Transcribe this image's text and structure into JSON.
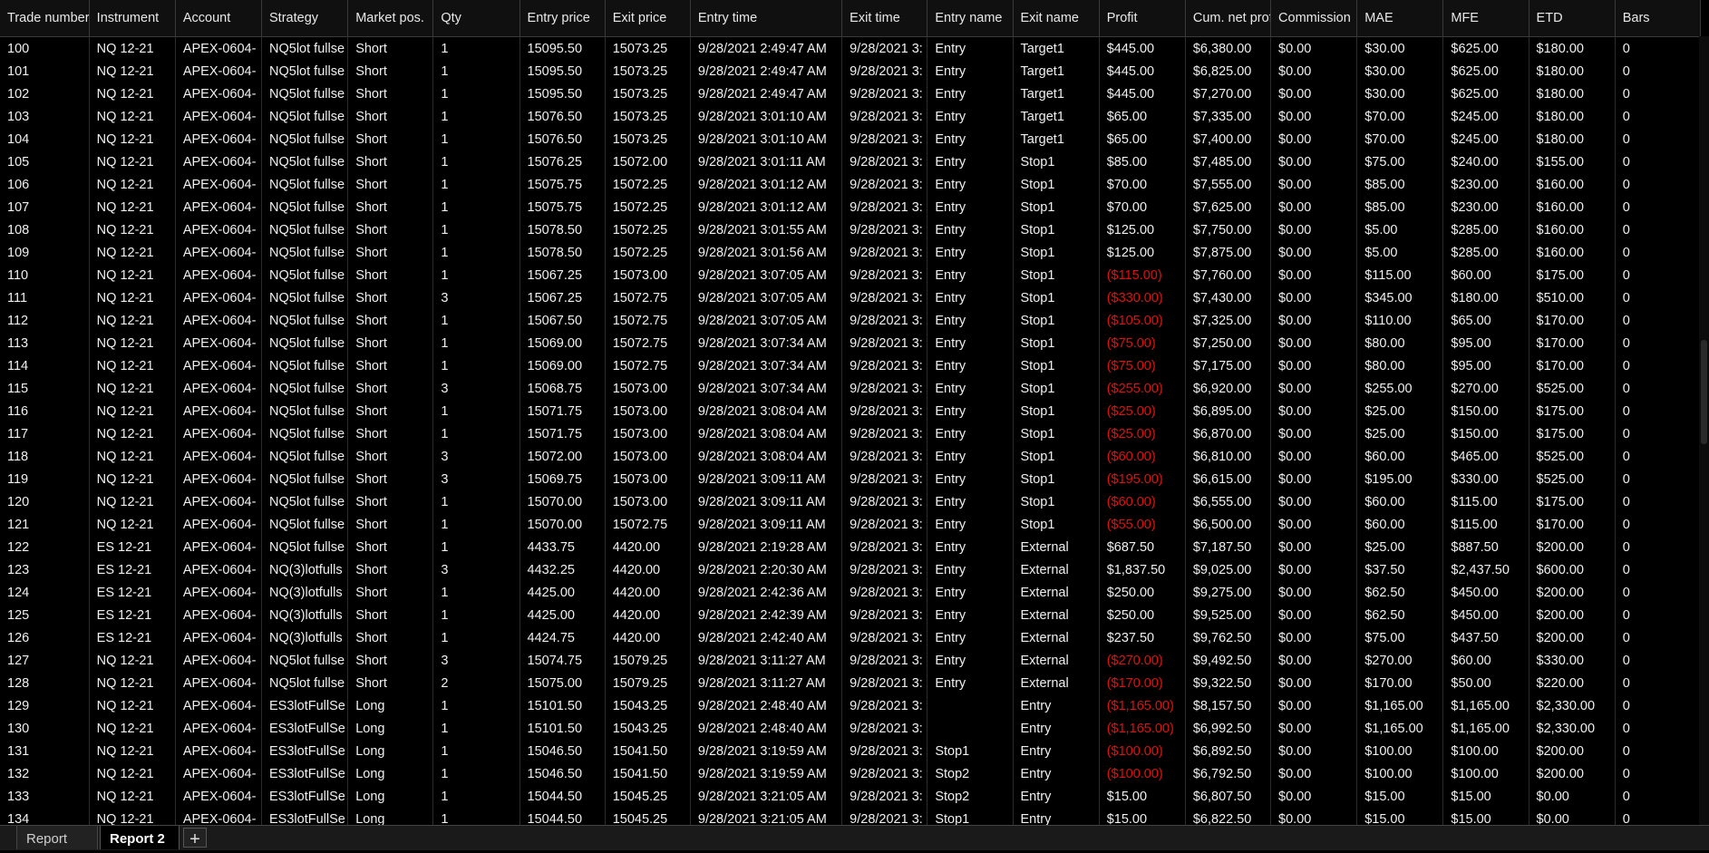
{
  "columns": [
    "Trade number",
    "Instrument",
    "Account",
    "Strategy",
    "Market pos.",
    "Qty",
    "Entry price",
    "Exit price",
    "Entry time",
    "Exit time",
    "Entry name",
    "Exit name",
    "Profit",
    "Cum. net profit",
    "Commission",
    "MAE",
    "MFE",
    "ETD",
    "Bars"
  ],
  "rows": [
    [
      "100",
      "NQ 12-21",
      "APEX-0604-",
      "NQ5lot fullse",
      "Short",
      "1",
      "15095.50",
      "15073.25",
      "9/28/2021 2:49:47 AM",
      "9/28/2021 3:",
      "Entry",
      "Target1",
      "$445.00",
      "$6,380.00",
      "$0.00",
      "$30.00",
      "$625.00",
      "$180.00",
      "0"
    ],
    [
      "101",
      "NQ 12-21",
      "APEX-0604-",
      "NQ5lot fullse",
      "Short",
      "1",
      "15095.50",
      "15073.25",
      "9/28/2021 2:49:47 AM",
      "9/28/2021 3:",
      "Entry",
      "Target1",
      "$445.00",
      "$6,825.00",
      "$0.00",
      "$30.00",
      "$625.00",
      "$180.00",
      "0"
    ],
    [
      "102",
      "NQ 12-21",
      "APEX-0604-",
      "NQ5lot fullse",
      "Short",
      "1",
      "15095.50",
      "15073.25",
      "9/28/2021 2:49:47 AM",
      "9/28/2021 3:",
      "Entry",
      "Target1",
      "$445.00",
      "$7,270.00",
      "$0.00",
      "$30.00",
      "$625.00",
      "$180.00",
      "0"
    ],
    [
      "103",
      "NQ 12-21",
      "APEX-0604-",
      "NQ5lot fullse",
      "Short",
      "1",
      "15076.50",
      "15073.25",
      "9/28/2021 3:01:10 AM",
      "9/28/2021 3:",
      "Entry",
      "Target1",
      "$65.00",
      "$7,335.00",
      "$0.00",
      "$70.00",
      "$245.00",
      "$180.00",
      "0"
    ],
    [
      "104",
      "NQ 12-21",
      "APEX-0604-",
      "NQ5lot fullse",
      "Short",
      "1",
      "15076.50",
      "15073.25",
      "9/28/2021 3:01:10 AM",
      "9/28/2021 3:",
      "Entry",
      "Target1",
      "$65.00",
      "$7,400.00",
      "$0.00",
      "$70.00",
      "$245.00",
      "$180.00",
      "0"
    ],
    [
      "105",
      "NQ 12-21",
      "APEX-0604-",
      "NQ5lot fullse",
      "Short",
      "1",
      "15076.25",
      "15072.00",
      "9/28/2021 3:01:11 AM",
      "9/28/2021 3:",
      "Entry",
      "Stop1",
      "$85.00",
      "$7,485.00",
      "$0.00",
      "$75.00",
      "$240.00",
      "$155.00",
      "0"
    ],
    [
      "106",
      "NQ 12-21",
      "APEX-0604-",
      "NQ5lot fullse",
      "Short",
      "1",
      "15075.75",
      "15072.25",
      "9/28/2021 3:01:12 AM",
      "9/28/2021 3:",
      "Entry",
      "Stop1",
      "$70.00",
      "$7,555.00",
      "$0.00",
      "$85.00",
      "$230.00",
      "$160.00",
      "0"
    ],
    [
      "107",
      "NQ 12-21",
      "APEX-0604-",
      "NQ5lot fullse",
      "Short",
      "1",
      "15075.75",
      "15072.25",
      "9/28/2021 3:01:12 AM",
      "9/28/2021 3:",
      "Entry",
      "Stop1",
      "$70.00",
      "$7,625.00",
      "$0.00",
      "$85.00",
      "$230.00",
      "$160.00",
      "0"
    ],
    [
      "108",
      "NQ 12-21",
      "APEX-0604-",
      "NQ5lot fullse",
      "Short",
      "1",
      "15078.50",
      "15072.25",
      "9/28/2021 3:01:55 AM",
      "9/28/2021 3:",
      "Entry",
      "Stop1",
      "$125.00",
      "$7,750.00",
      "$0.00",
      "$5.00",
      "$285.00",
      "$160.00",
      "0"
    ],
    [
      "109",
      "NQ 12-21",
      "APEX-0604-",
      "NQ5lot fullse",
      "Short",
      "1",
      "15078.50",
      "15072.25",
      "9/28/2021 3:01:56 AM",
      "9/28/2021 3:",
      "Entry",
      "Stop1",
      "$125.00",
      "$7,875.00",
      "$0.00",
      "$5.00",
      "$285.00",
      "$160.00",
      "0"
    ],
    [
      "110",
      "NQ 12-21",
      "APEX-0604-",
      "NQ5lot fullse",
      "Short",
      "1",
      "15067.25",
      "15073.00",
      "9/28/2021 3:07:05 AM",
      "9/28/2021 3:",
      "Entry",
      "Stop1",
      "($115.00)",
      "$7,760.00",
      "$0.00",
      "$115.00",
      "$60.00",
      "$175.00",
      "0"
    ],
    [
      "111",
      "NQ 12-21",
      "APEX-0604-",
      "NQ5lot fullse",
      "Short",
      "3",
      "15067.25",
      "15072.75",
      "9/28/2021 3:07:05 AM",
      "9/28/2021 3:",
      "Entry",
      "Stop1",
      "($330.00)",
      "$7,430.00",
      "$0.00",
      "$345.00",
      "$180.00",
      "$510.00",
      "0"
    ],
    [
      "112",
      "NQ 12-21",
      "APEX-0604-",
      "NQ5lot fullse",
      "Short",
      "1",
      "15067.50",
      "15072.75",
      "9/28/2021 3:07:05 AM",
      "9/28/2021 3:",
      "Entry",
      "Stop1",
      "($105.00)",
      "$7,325.00",
      "$0.00",
      "$110.00",
      "$65.00",
      "$170.00",
      "0"
    ],
    [
      "113",
      "NQ 12-21",
      "APEX-0604-",
      "NQ5lot fullse",
      "Short",
      "1",
      "15069.00",
      "15072.75",
      "9/28/2021 3:07:34 AM",
      "9/28/2021 3:",
      "Entry",
      "Stop1",
      "($75.00)",
      "$7,250.00",
      "$0.00",
      "$80.00",
      "$95.00",
      "$170.00",
      "0"
    ],
    [
      "114",
      "NQ 12-21",
      "APEX-0604-",
      "NQ5lot fullse",
      "Short",
      "1",
      "15069.00",
      "15072.75",
      "9/28/2021 3:07:34 AM",
      "9/28/2021 3:",
      "Entry",
      "Stop1",
      "($75.00)",
      "$7,175.00",
      "$0.00",
      "$80.00",
      "$95.00",
      "$170.00",
      "0"
    ],
    [
      "115",
      "NQ 12-21",
      "APEX-0604-",
      "NQ5lot fullse",
      "Short",
      "3",
      "15068.75",
      "15073.00",
      "9/28/2021 3:07:34 AM",
      "9/28/2021 3:",
      "Entry",
      "Stop1",
      "($255.00)",
      "$6,920.00",
      "$0.00",
      "$255.00",
      "$270.00",
      "$525.00",
      "0"
    ],
    [
      "116",
      "NQ 12-21",
      "APEX-0604-",
      "NQ5lot fullse",
      "Short",
      "1",
      "15071.75",
      "15073.00",
      "9/28/2021 3:08:04 AM",
      "9/28/2021 3:",
      "Entry",
      "Stop1",
      "($25.00)",
      "$6,895.00",
      "$0.00",
      "$25.00",
      "$150.00",
      "$175.00",
      "0"
    ],
    [
      "117",
      "NQ 12-21",
      "APEX-0604-",
      "NQ5lot fullse",
      "Short",
      "1",
      "15071.75",
      "15073.00",
      "9/28/2021 3:08:04 AM",
      "9/28/2021 3:",
      "Entry",
      "Stop1",
      "($25.00)",
      "$6,870.00",
      "$0.00",
      "$25.00",
      "$150.00",
      "$175.00",
      "0"
    ],
    [
      "118",
      "NQ 12-21",
      "APEX-0604-",
      "NQ5lot fullse",
      "Short",
      "3",
      "15072.00",
      "15073.00",
      "9/28/2021 3:08:04 AM",
      "9/28/2021 3:",
      "Entry",
      "Stop1",
      "($60.00)",
      "$6,810.00",
      "$0.00",
      "$60.00",
      "$465.00",
      "$525.00",
      "0"
    ],
    [
      "119",
      "NQ 12-21",
      "APEX-0604-",
      "NQ5lot fullse",
      "Short",
      "3",
      "15069.75",
      "15073.00",
      "9/28/2021 3:09:11 AM",
      "9/28/2021 3:",
      "Entry",
      "Stop1",
      "($195.00)",
      "$6,615.00",
      "$0.00",
      "$195.00",
      "$330.00",
      "$525.00",
      "0"
    ],
    [
      "120",
      "NQ 12-21",
      "APEX-0604-",
      "NQ5lot fullse",
      "Short",
      "1",
      "15070.00",
      "15073.00",
      "9/28/2021 3:09:11 AM",
      "9/28/2021 3:",
      "Entry",
      "Stop1",
      "($60.00)",
      "$6,555.00",
      "$0.00",
      "$60.00",
      "$115.00",
      "$175.00",
      "0"
    ],
    [
      "121",
      "NQ 12-21",
      "APEX-0604-",
      "NQ5lot fullse",
      "Short",
      "1",
      "15070.00",
      "15072.75",
      "9/28/2021 3:09:11 AM",
      "9/28/2021 3:",
      "Entry",
      "Stop1",
      "($55.00)",
      "$6,500.00",
      "$0.00",
      "$60.00",
      "$115.00",
      "$170.00",
      "0"
    ],
    [
      "122",
      "ES 12-21",
      "APEX-0604-",
      "NQ5lot fullse",
      "Short",
      "1",
      "4433.75",
      "4420.00",
      "9/28/2021 2:19:28 AM",
      "9/28/2021 3:",
      "Entry",
      "External",
      "$687.50",
      "$7,187.50",
      "$0.00",
      "$25.00",
      "$887.50",
      "$200.00",
      "0"
    ],
    [
      "123",
      "ES 12-21",
      "APEX-0604-",
      "NQ(3)lotfulls",
      "Short",
      "3",
      "4432.25",
      "4420.00",
      "9/28/2021 2:20:30 AM",
      "9/28/2021 3:",
      "Entry",
      "External",
      "$1,837.50",
      "$9,025.00",
      "$0.00",
      "$37.50",
      "$2,437.50",
      "$600.00",
      "0"
    ],
    [
      "124",
      "ES 12-21",
      "APEX-0604-",
      "NQ(3)lotfulls",
      "Short",
      "1",
      "4425.00",
      "4420.00",
      "9/28/2021 2:42:36 AM",
      "9/28/2021 3:",
      "Entry",
      "External",
      "$250.00",
      "$9,275.00",
      "$0.00",
      "$62.50",
      "$450.00",
      "$200.00",
      "0"
    ],
    [
      "125",
      "ES 12-21",
      "APEX-0604-",
      "NQ(3)lotfulls",
      "Short",
      "1",
      "4425.00",
      "4420.00",
      "9/28/2021 2:42:39 AM",
      "9/28/2021 3:",
      "Entry",
      "External",
      "$250.00",
      "$9,525.00",
      "$0.00",
      "$62.50",
      "$450.00",
      "$200.00",
      "0"
    ],
    [
      "126",
      "ES 12-21",
      "APEX-0604-",
      "NQ(3)lotfulls",
      "Short",
      "1",
      "4424.75",
      "4420.00",
      "9/28/2021 2:42:40 AM",
      "9/28/2021 3:",
      "Entry",
      "External",
      "$237.50",
      "$9,762.50",
      "$0.00",
      "$75.00",
      "$437.50",
      "$200.00",
      "0"
    ],
    [
      "127",
      "NQ 12-21",
      "APEX-0604-",
      "NQ5lot fullse",
      "Short",
      "3",
      "15074.75",
      "15079.25",
      "9/28/2021 3:11:27 AM",
      "9/28/2021 3:",
      "Entry",
      "External",
      "($270.00)",
      "$9,492.50",
      "$0.00",
      "$270.00",
      "$60.00",
      "$330.00",
      "0"
    ],
    [
      "128",
      "NQ 12-21",
      "APEX-0604-",
      "NQ5lot fullse",
      "Short",
      "2",
      "15075.00",
      "15079.25",
      "9/28/2021 3:11:27 AM",
      "9/28/2021 3:",
      "Entry",
      "External",
      "($170.00)",
      "$9,322.50",
      "$0.00",
      "$170.00",
      "$50.00",
      "$220.00",
      "0"
    ],
    [
      "129",
      "NQ 12-21",
      "APEX-0604-",
      "ES3lotFullSe",
      "Long",
      "1",
      "15101.50",
      "15043.25",
      "9/28/2021 2:48:40 AM",
      "9/28/2021 3:",
      "",
      "Entry",
      "($1,165.00)",
      "$8,157.50",
      "$0.00",
      "$1,165.00",
      "$1,165.00",
      "$2,330.00",
      "0"
    ],
    [
      "130",
      "NQ 12-21",
      "APEX-0604-",
      "ES3lotFullSe",
      "Long",
      "1",
      "15101.50",
      "15043.25",
      "9/28/2021 2:48:40 AM",
      "9/28/2021 3:",
      "",
      "Entry",
      "($1,165.00)",
      "$6,992.50",
      "$0.00",
      "$1,165.00",
      "$1,165.00",
      "$2,330.00",
      "0"
    ],
    [
      "131",
      "NQ 12-21",
      "APEX-0604-",
      "ES3lotFullSe",
      "Long",
      "1",
      "15046.50",
      "15041.50",
      "9/28/2021 3:19:59 AM",
      "9/28/2021 3:",
      "Stop1",
      "Entry",
      "($100.00)",
      "$6,892.50",
      "$0.00",
      "$100.00",
      "$100.00",
      "$200.00",
      "0"
    ],
    [
      "132",
      "NQ 12-21",
      "APEX-0604-",
      "ES3lotFullSe",
      "Long",
      "1",
      "15046.50",
      "15041.50",
      "9/28/2021 3:19:59 AM",
      "9/28/2021 3:",
      "Stop2",
      "Entry",
      "($100.00)",
      "$6,792.50",
      "$0.00",
      "$100.00",
      "$100.00",
      "$200.00",
      "0"
    ],
    [
      "133",
      "NQ 12-21",
      "APEX-0604-",
      "ES3lotFullSe",
      "Long",
      "1",
      "15044.50",
      "15045.25",
      "9/28/2021 3:21:05 AM",
      "9/28/2021 3:",
      "Stop2",
      "Entry",
      "$15.00",
      "$6,807.50",
      "$0.00",
      "$15.00",
      "$15.00",
      "$0.00",
      "0"
    ],
    [
      "134",
      "NQ 12-21",
      "APEX-0604-",
      "ES3lotFullSe",
      "Long",
      "1",
      "15044.50",
      "15045.25",
      "9/28/2021 3:21:05 AM",
      "9/28/2021 3:",
      "Stop1",
      "Entry",
      "$15.00",
      "$6,822.50",
      "$0.00",
      "$15.00",
      "$15.00",
      "$0.00",
      "0"
    ]
  ],
  "tabs": {
    "report": "Report",
    "report2": "Report 2",
    "add": "+"
  },
  "colors": {
    "negative": "#e01010",
    "background": "#000000"
  }
}
